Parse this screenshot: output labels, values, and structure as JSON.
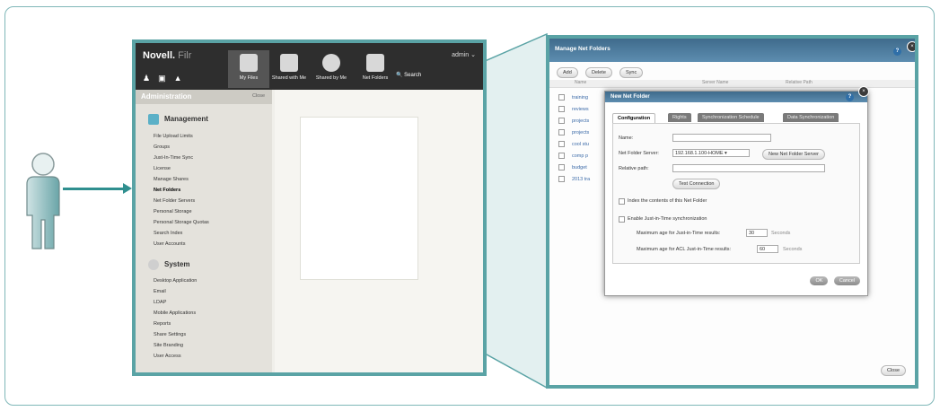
{
  "small_screen": {
    "logo": "Novell.",
    "logo_product": "Filr",
    "admin_link": "admin ⌄",
    "nav": [
      "My Files",
      "Shared with Me",
      "Shared by Me",
      "Net Folders"
    ],
    "search_label": "Search",
    "sidebar": {
      "title": "Administration",
      "close": "Close",
      "sections": [
        {
          "label": "Management",
          "items": [
            "File Upload Limits",
            "Groups",
            "Just-In-Time Sync",
            "License",
            "Manage Shares",
            "Net Folders",
            "Net Folder Servers",
            "Personal Storage",
            "Personal Storage Quotas",
            "Search Index",
            "User Accounts"
          ]
        },
        {
          "label": "System",
          "items": [
            "Desktop Application",
            "Email",
            "LDAP",
            "Mobile Applications",
            "Reports",
            "Share Settings",
            "Site Branding",
            "User Access"
          ]
        }
      ]
    }
  },
  "manage_net_folders": {
    "title": "Manage Net Folders",
    "buttons": [
      "Add",
      "Delete",
      "Sync"
    ],
    "columns": [
      "Name",
      "Server Name",
      "Relative Path"
    ],
    "rows": [
      "training",
      "reviews",
      "projects",
      "projects",
      "cool stu",
      "comp p",
      "budget",
      "2013 tra"
    ],
    "close_label": "Close"
  },
  "new_net_folder": {
    "title": "New Net Folder",
    "tabs": [
      "Configuration",
      "Rights",
      "Synchronization Schedule",
      "Data Synchronization"
    ],
    "name_label": "Name:",
    "server_label": "Net Folder Server:",
    "server_value": "192.168.1.100-HOME  ▾",
    "new_server_button": "New Net Folder Server",
    "relative_path_label": "Relative path:",
    "test_connection": "Test Connection",
    "index_label": "Index the contents of this Net Folder",
    "jit_label": "Enable Just-in-Time synchronization",
    "max_age_label": "Maximum age for Just-in-Time results:",
    "max_age_value": "30",
    "max_age_unit": "Seconds",
    "max_acl_label": "Maximum age for ACL Just-in-Time results:",
    "max_acl_value": "60",
    "max_acl_unit": "Seconds",
    "ok": "OK",
    "cancel": "Cancel"
  }
}
